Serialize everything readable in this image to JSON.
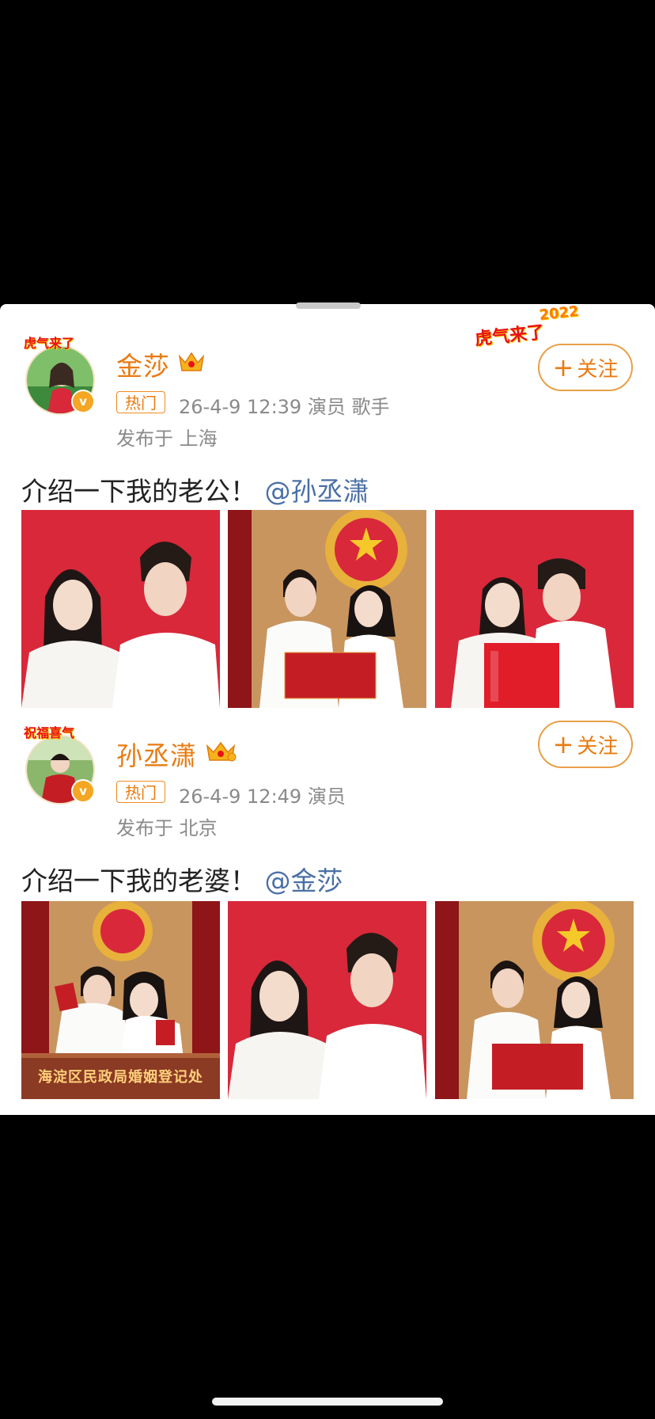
{
  "posts": [
    {
      "author": "金莎",
      "avatar_banner": "虎气来了",
      "hot_label": "热门",
      "meta": "26-4-9 12:39   演员 歌手",
      "location": "发布于 上海",
      "follow_label": "关注",
      "text": "介绍一下我的老公！",
      "mention": "@孙丞潇",
      "photos": [
        "couple-portrait-red-background",
        "couple-holding-marriage-certificate",
        "couple-with-double-happiness-sign"
      ]
    },
    {
      "author": "孙丞潇",
      "avatar_banner": "祝福喜气",
      "hot_label": "热门",
      "meta": "26-4-9 12:49   演员",
      "location": "发布于 北京",
      "follow_label": "关注",
      "text": "介绍一下我的老婆！",
      "mention": "@金莎",
      "photos": [
        "couple-at-registry-office",
        "couple-portrait-red-background",
        "couple-holding-marriage-certificate"
      ]
    }
  ],
  "decoration": {
    "tiger_text": "虎气来了",
    "year_text": "2022"
  },
  "registry_sign": "海淀区民政局婚姻登记处",
  "colors": {
    "accent": "#e87b12",
    "mention": "#4a6fa5",
    "photo_red": "#d8283a"
  }
}
